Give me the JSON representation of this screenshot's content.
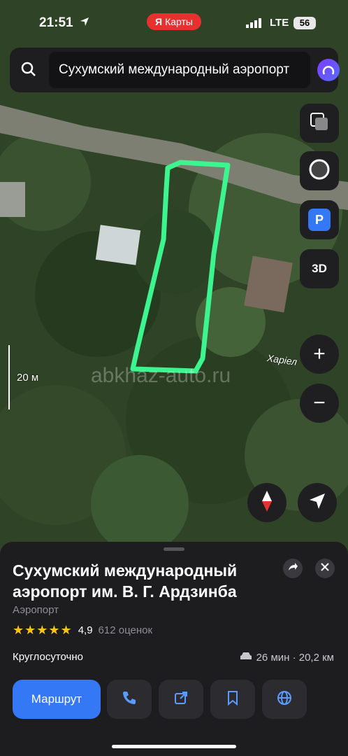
{
  "status_bar": {
    "time": "21:51",
    "app_pill_logo": "Я",
    "app_pill_label": "Карты",
    "network": "LTE",
    "battery": "56"
  },
  "search": {
    "value": "Сухумский международный аэропорт"
  },
  "map_controls": {
    "layers_icon": "layers-icon",
    "mode_icon": "circle-mode-icon",
    "parking_label": "P",
    "threed_label": "3D",
    "zoom_in": "+",
    "zoom_out": "−",
    "compass_icon": "compass-icon",
    "locate_icon": "navigation-arrow-icon"
  },
  "map": {
    "scale_label": "20 м",
    "watermark": "abkhaz-auto.ru",
    "street_label": "Харіел",
    "highlight_color": "#3df58f"
  },
  "place": {
    "title": "Сухумский международный аэропорт им. В. Г. Ардзинба",
    "category": "Аэропорт",
    "stars": "★★★★★",
    "rating": "4,9",
    "reviews": "612 оценок",
    "hours": "Круглосуточно",
    "travel": "26 мин · 20,2 км"
  },
  "actions": {
    "route_label": "Маршрут",
    "buttons": [
      "phone-icon",
      "share-link-icon",
      "bookmark-icon",
      "globe-icon"
    ]
  },
  "colors": {
    "accent": "#3478f6",
    "sheet_bg": "#1d1d20",
    "pill": "#e8312f"
  }
}
